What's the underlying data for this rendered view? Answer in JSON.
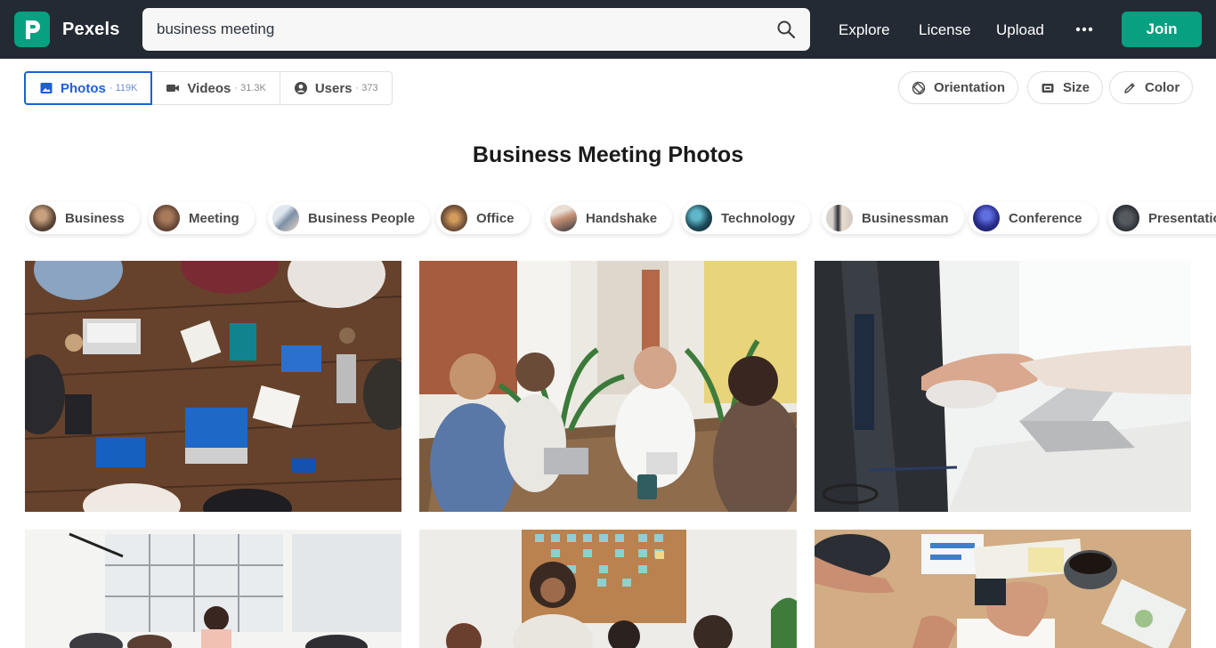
{
  "header": {
    "logo_text": "Pexels",
    "search_value": "business meeting",
    "nav": [
      "Explore",
      "License",
      "Upload"
    ],
    "join_label": "Join",
    "colors": {
      "bar": "#232a34",
      "brand": "#07a081"
    }
  },
  "tabs": [
    {
      "label": "Photos",
      "count": "· 119K",
      "icon": "image-icon",
      "active": true
    },
    {
      "label": "Videos",
      "count": "· 31.3K",
      "icon": "video-camera-icon",
      "active": false
    },
    {
      "label": "Users",
      "count": "· 373",
      "icon": "user-circle-icon",
      "active": false
    }
  ],
  "filters": [
    {
      "label": "Orientation",
      "icon": "orientation-icon"
    },
    {
      "label": "Size",
      "icon": "size-icon"
    },
    {
      "label": "Color",
      "icon": "pencil-icon"
    }
  ],
  "page_title": "Business Meeting Photos",
  "related": [
    "Business",
    "Meeting",
    "Business People",
    "Office",
    "Handshake",
    "Technology",
    "Businessman",
    "Conference",
    "Presentation"
  ],
  "accent_color": "#1d5fd6"
}
